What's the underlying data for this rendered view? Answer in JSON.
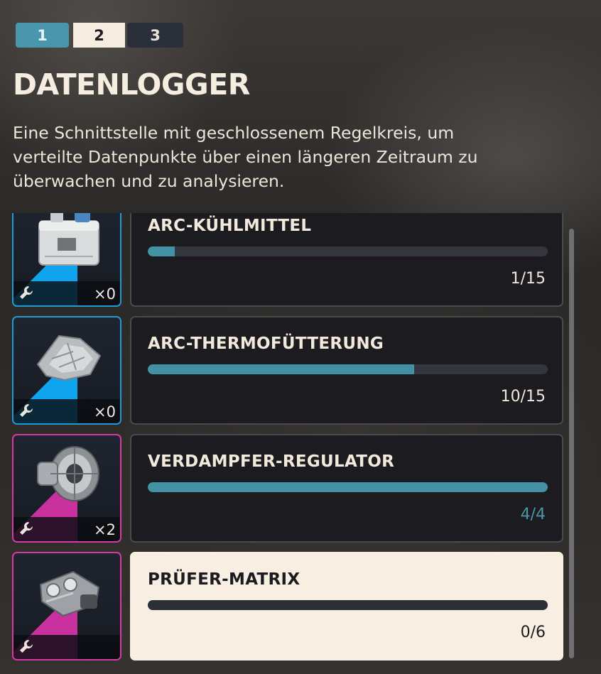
{
  "tabs": [
    "1",
    "2",
    "3"
  ],
  "title": "DATENLOGGER",
  "description": "Eine Schnittstelle mit geschlossenem Regelkreis, um verteilte Datenpunkte über einen längeren Zeitraum zu überwachen und zu analysieren.",
  "items": [
    {
      "name": "ARC-KÜHLMITTEL",
      "count": "×0",
      "progress_text": "1/15",
      "progress": 0.0667,
      "rarity": "blue",
      "icon": "coolant-canister-icon"
    },
    {
      "name": "ARC-THERMOFÜTTERUNG",
      "count": "×0",
      "progress_text": "10/15",
      "progress": 0.6667,
      "rarity": "blue",
      "icon": "thermal-lining-icon"
    },
    {
      "name": "VERDAMPFER-REGULATOR",
      "count": "×2",
      "progress_text": "4/4",
      "progress": 1.0,
      "rarity": "pink",
      "icon": "regulator-icon"
    },
    {
      "name": "PRÜFER-MATRIX",
      "count": "",
      "progress_text": "0/6",
      "progress": 0.0,
      "rarity": "pink",
      "icon": "matrix-part-icon"
    }
  ],
  "colors": {
    "accent": "#4a97ad",
    "rarity_blue": "#11a4ee",
    "rarity_pink": "#c9319e",
    "highlight_card": "#f8eee2"
  }
}
